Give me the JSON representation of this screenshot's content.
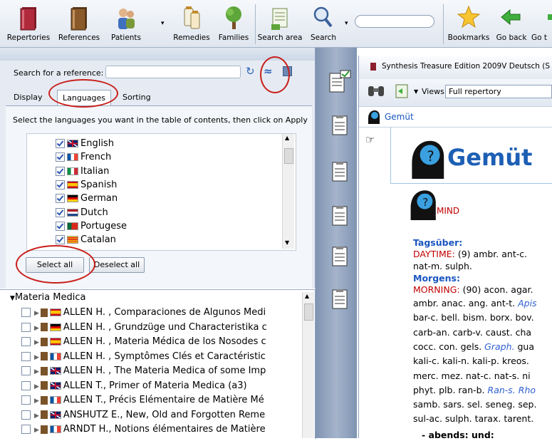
{
  "toolbar": {
    "items": [
      {
        "label": "Repertories",
        "icon": "repertory-book-icon"
      },
      {
        "label": "References",
        "icon": "references-book-icon"
      },
      {
        "label": "Patients",
        "icon": "patients-icon"
      },
      {
        "label": "Remedies",
        "icon": "remedies-icon"
      },
      {
        "label": "Families",
        "icon": "families-tree-icon"
      },
      {
        "label": "Search area",
        "icon": "search-area-icon"
      },
      {
        "label": "Search",
        "icon": "search-icon"
      },
      {
        "label": "Bookmarks",
        "icon": "bookmark-star-icon"
      },
      {
        "label": "Go back",
        "icon": "go-back-arrow-icon"
      },
      {
        "label": "Go t",
        "icon": "go-to-icon"
      }
    ],
    "search_value": ""
  },
  "left": {
    "search_label": "Search for a reference:",
    "search_value": "",
    "tabs": [
      "Display",
      "Languages",
      "Sorting"
    ],
    "instruction": "Select the languages you want in the table of contents, then click on Apply",
    "languages": [
      {
        "name": "English",
        "checked": true,
        "flag": "uk"
      },
      {
        "name": "French",
        "checked": true,
        "flag": "fr"
      },
      {
        "name": "Italian",
        "checked": true,
        "flag": "it"
      },
      {
        "name": "Spanish",
        "checked": true,
        "flag": "es"
      },
      {
        "name": "German",
        "checked": true,
        "flag": "de"
      },
      {
        "name": "Dutch",
        "checked": true,
        "flag": "nl"
      },
      {
        "name": "Portugese",
        "checked": true,
        "flag": "pt"
      },
      {
        "name": "Catalan",
        "checked": true,
        "flag": "ca"
      }
    ],
    "select_all": "Select all",
    "deselect_all": "Deselect all",
    "tree_root": "Materia Medica",
    "books": [
      {
        "title": "ALLEN H. , Comparaciones de Algunos Medi",
        "flag": "es"
      },
      {
        "title": "ALLEN H. , Grundzüge und Characteristika c",
        "flag": "de"
      },
      {
        "title": "ALLEN H. , Materia Médica de los Nosodes c",
        "flag": "es"
      },
      {
        "title": "ALLEN H. , Symptômes Clés et Caractéristic",
        "flag": "fr"
      },
      {
        "title": "ALLEN H. , The Materia Medica of some Imp",
        "flag": "uk"
      },
      {
        "title": "ALLEN T., Primer of Materia Medica (a3)",
        "flag": "uk"
      },
      {
        "title": "ALLEN T., Précis Elémentaire de Matière Mé",
        "flag": "fr"
      },
      {
        "title": "ANSHUTZ E., New, Old and Forgotten Reme",
        "flag": "uk"
      },
      {
        "title": "ARNDT H., Notions élémentaires de Matière",
        "flag": "fr"
      }
    ]
  },
  "right": {
    "title": "Synthesis Treasure Edition 2009V Deutsch (S",
    "views_label": "Views:",
    "views_value": "Full repertory",
    "breadcrumb": "Gemüt",
    "heading": "Gemüt",
    "sub_heading": "MIND",
    "section1_de": "Tagsüber:",
    "section1_en": "DAYTIME:",
    "section1_count": "(9)",
    "section1_line1": "ambr. ant-c.",
    "section1_line2": "nat-m. sulph.",
    "section2_de": "Morgens:",
    "section2_en": "MORNING:",
    "section2_count": "(90)",
    "section2_first": "acon. agar.",
    "lines": [
      {
        "a": "ambr. anac. ang. ant-t. ",
        "b": "Apis"
      },
      {
        "a": "bar-c. bell. bism. borx. bov.",
        "b": ""
      },
      {
        "a": "carb-an. carb-v. caust. cha",
        "b": ""
      },
      {
        "a": "cocc. con. gels. ",
        "b": "Graph.",
        "c": " gua"
      },
      {
        "a": "kali-c. kali-n. kali-p. kreos.",
        "b": ""
      },
      {
        "a": "merc. mez. nat-c. nat-s. ni",
        "b": ""
      },
      {
        "a": "phyt. plb. ran-b. ",
        "b": "Ran-s. Rho"
      },
      {
        "a": "samb. sars. sel. seneg. sep.",
        "b": ""
      },
      {
        "a": "sul-ac. sulph. tarax. tarent.",
        "b": ""
      }
    ],
    "last_line": "- abends: und:"
  },
  "colors": {
    "accent_red": "#c8201c",
    "link_blue": "#1a55c0"
  }
}
